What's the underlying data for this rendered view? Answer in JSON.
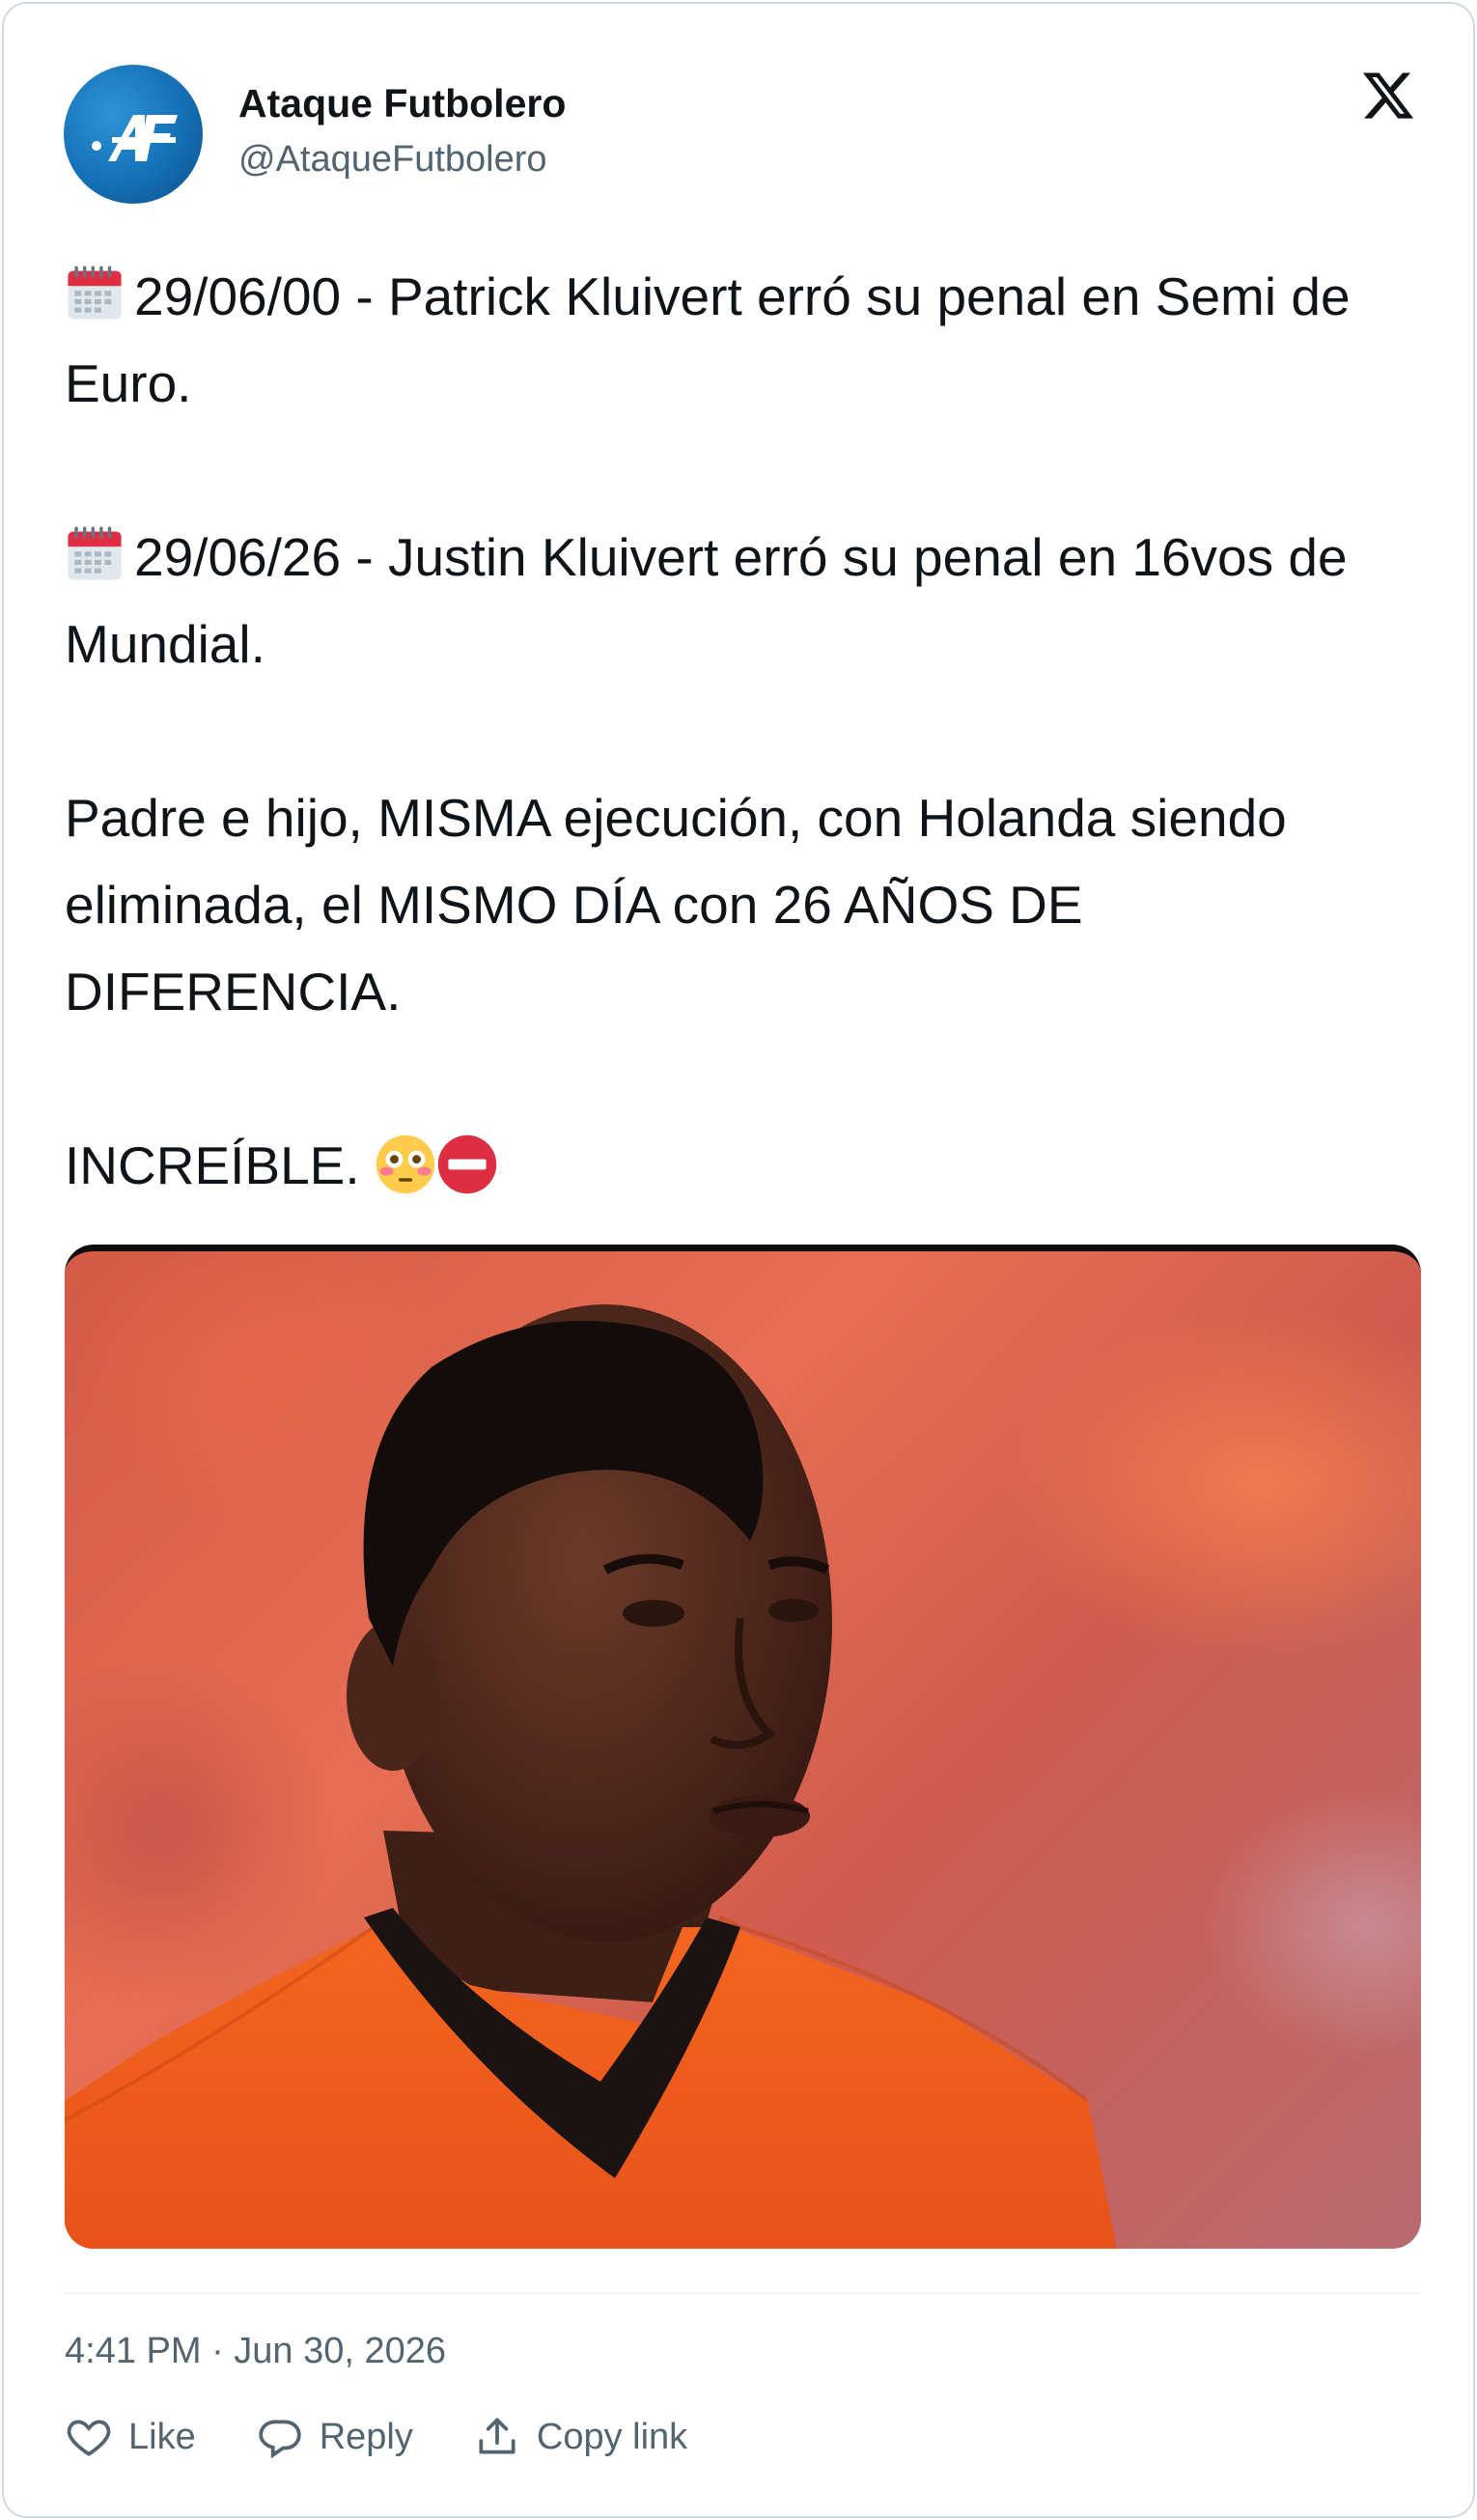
{
  "author": {
    "name": "Ataque Futbolero",
    "handle": "@AtaqueFutbolero",
    "avatar_logo_text": "AF",
    "avatar_color": "#1570b5"
  },
  "platform_icon": "x-logo-icon",
  "tweet": {
    "line1": "29/06/00 - Patrick Kluivert erró su penal en Semi de Euro.",
    "line2": "29/06/26 - Justin Kluivert erró su penal en 16vos de Mundial.",
    "line3": "Padre e hijo, MISMA ejecución, con Holanda siendo eliminada, el MISMO DÍA con 26 AÑOS DE DIFERENCIA.",
    "line4": "INCREÍBLE.",
    "line1_icon": "calendar-icon",
    "line2_icon": "calendar-icon",
    "line4_icons": [
      "flushed-face-icon",
      "no-entry-icon"
    ]
  },
  "media": {
    "description_icon": "player-photo",
    "jersey_color": "#f15a1d"
  },
  "timestamp": "4:41 PM · Jun 30, 2026",
  "actions": {
    "like": "Like",
    "reply": "Reply",
    "copy_link": "Copy link"
  }
}
